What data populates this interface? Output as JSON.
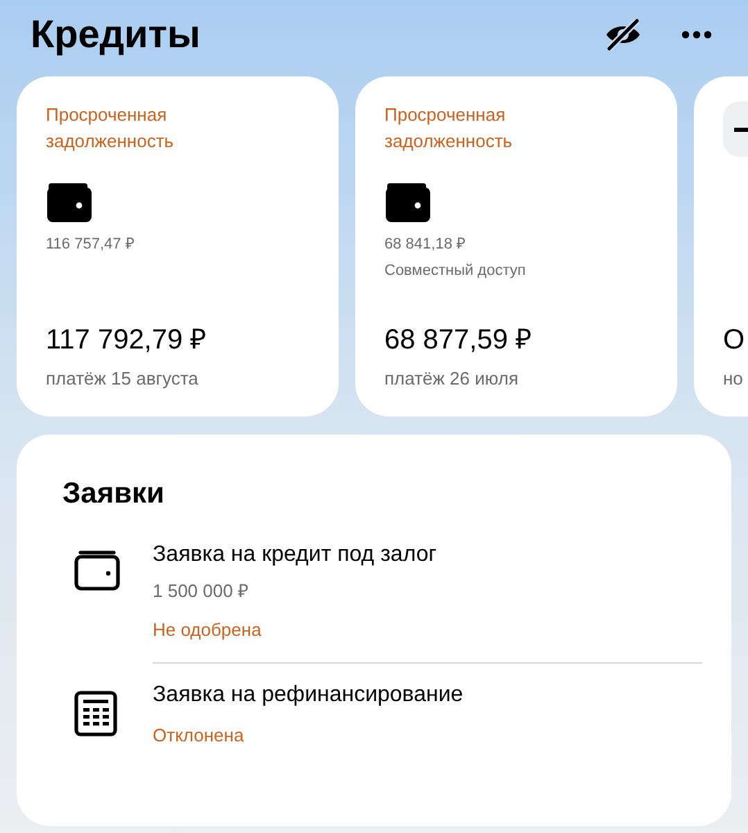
{
  "header": {
    "title": "Кредиты"
  },
  "loans": [
    {
      "kind": "wallet",
      "status": "Просроченная задолженность",
      "overdue_amount": "116 757,47 ₽",
      "amount": "117 792,79 ₽",
      "payment": "платёж 15 августа"
    },
    {
      "kind": "wallet",
      "status": "Просроченная задолженность",
      "overdue_amount": "68 841,18 ₽",
      "note": "Совместный доступ",
      "amount": "68 877,59 ₽",
      "payment": "платёж 26 июля"
    },
    {
      "kind": "dash",
      "amount": "О",
      "payment": "но"
    }
  ],
  "applications": {
    "title": "Заявки",
    "items": [
      {
        "kind": "wallet",
        "title": "Заявка на кредит под залог",
        "amount": "1 500 000 ₽",
        "status": "Не одобрена"
      },
      {
        "kind": "calculator",
        "title": "Заявка на рефинансирование",
        "status": "Отклонена"
      }
    ]
  }
}
